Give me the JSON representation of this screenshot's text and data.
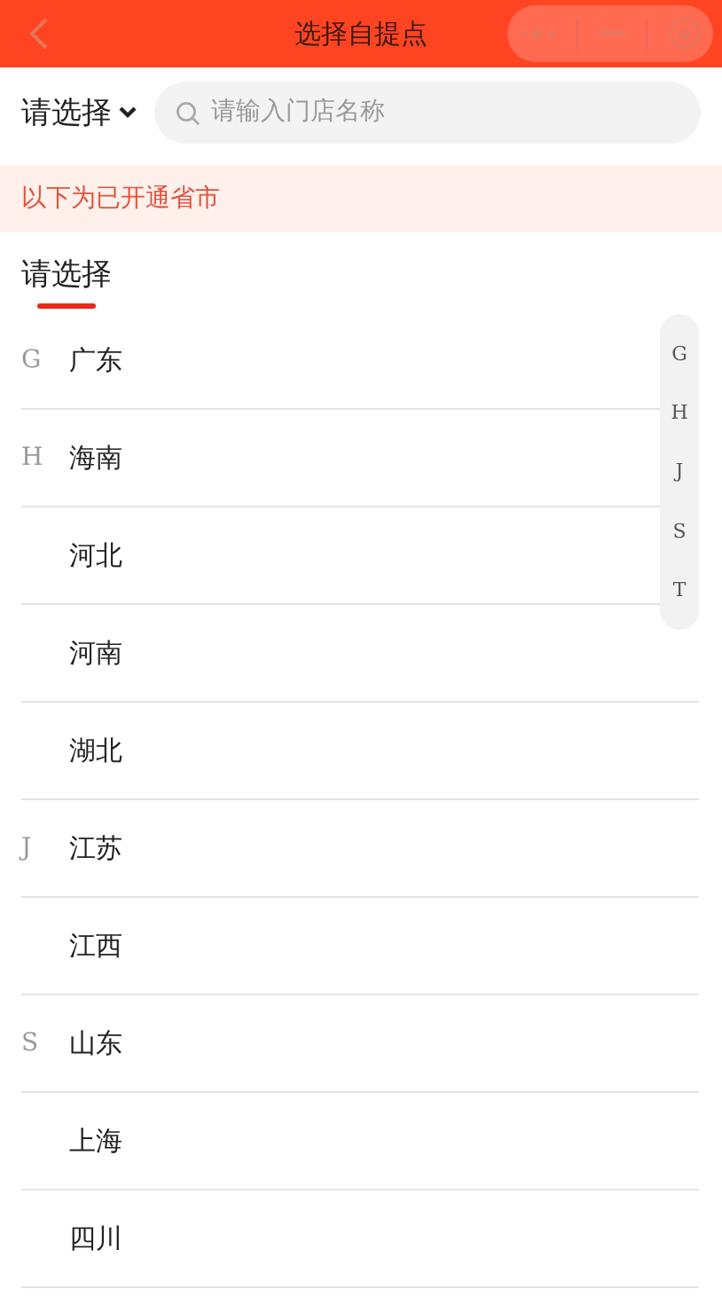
{
  "header": {
    "title": "选择自提点"
  },
  "filter": {
    "label": "请选择"
  },
  "search": {
    "placeholder": "请输入门店名称"
  },
  "notice": "以下为已开通省市",
  "tabs": [
    {
      "label": "请选择",
      "selected": true
    }
  ],
  "provinces": [
    {
      "letter": "G",
      "name": "广东"
    },
    {
      "letter": "H",
      "name": "海南"
    },
    {
      "name": "河北"
    },
    {
      "name": "河南"
    },
    {
      "name": "湖北"
    },
    {
      "letter": "J",
      "name": "江苏"
    },
    {
      "name": "江西"
    },
    {
      "letter": "S",
      "name": "山东"
    },
    {
      "name": "上海"
    },
    {
      "name": "四川"
    }
  ],
  "index": [
    "G",
    "H",
    "J",
    "S",
    "T"
  ]
}
